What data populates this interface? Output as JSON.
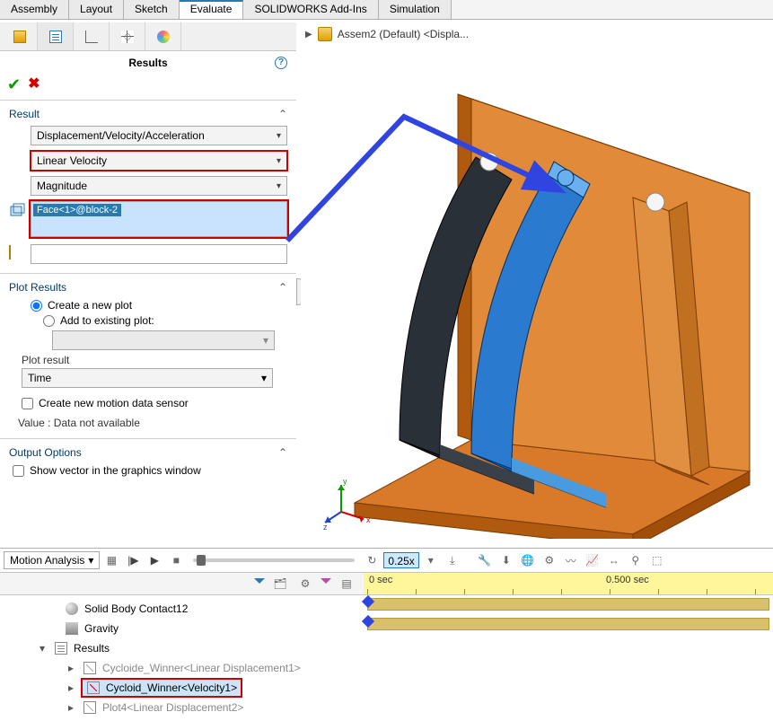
{
  "tabs": [
    "Assembly",
    "Layout",
    "Sketch",
    "Evaluate",
    "SOLIDWORKS Add-Ins",
    "Simulation"
  ],
  "activeTab": "Evaluate",
  "breadcrumb": "Assem2 (Default) <Displa...",
  "panel": {
    "title": "Results",
    "sections": {
      "result": {
        "header": "Result",
        "dd1": "Displacement/Velocity/Acceleration",
        "dd2": "Linear Velocity",
        "dd3": "Magnitude",
        "entity": "Face<1>@block-2"
      },
      "plotResults": {
        "header": "Plot Results",
        "opt1": "Create a new plot",
        "opt2": "Add to existing plot:",
        "plotResultLabel": "Plot result",
        "plotResultValue": "Time",
        "sensor": "Create new motion data sensor",
        "valueLine": "Value : Data not available"
      },
      "output": {
        "header": "Output Options",
        "showVector": "Show vector in the graphics window"
      }
    }
  },
  "motionBar": {
    "mode": "Motion Analysis",
    "speed": "0.25x"
  },
  "timeline": {
    "tick0": "0 sec",
    "tick1": "0.500 sec"
  },
  "tree": {
    "r1": "Solid Body Contact12",
    "r2": "Gravity",
    "r3": "Results",
    "r4": "Cycloide_Winner<Linear Displacement1>",
    "r5": "Cycloid_Winner<Velocity1>",
    "r6": "Plot4<Linear Displacement2>"
  },
  "triad": {
    "x": "x",
    "y": "y",
    "z": "z"
  }
}
